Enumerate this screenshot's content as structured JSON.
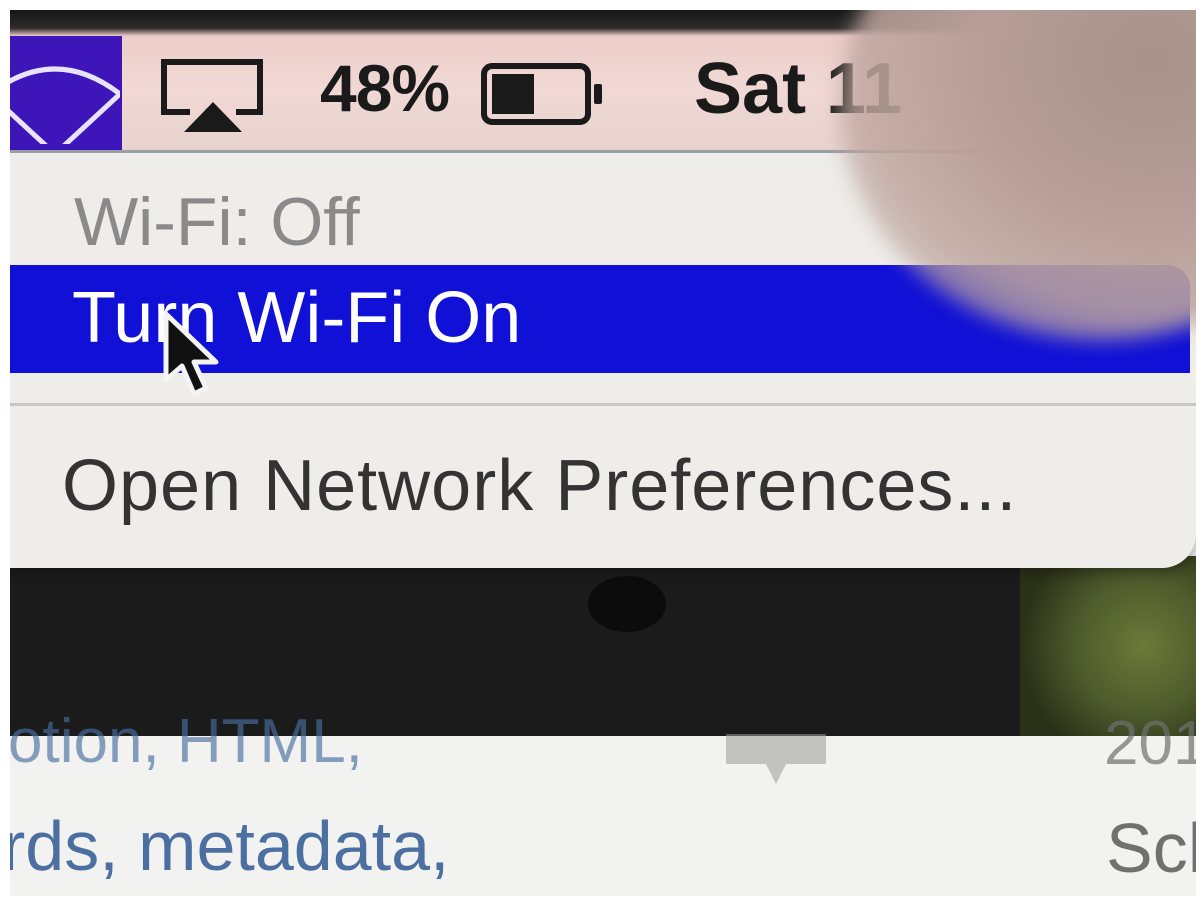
{
  "menubar": {
    "battery_percent": "48%",
    "battery_level": 0.48,
    "clock": "Sat 11"
  },
  "wifi_menu": {
    "status": "Wi-Fi: Off",
    "toggle": "Turn Wi-Fi On",
    "preferences": "Open Network Preferences..."
  },
  "background_page": {
    "line1": "otion, HTML,",
    "line2": "rds, metadata,",
    "right_line1": "201",
    "right_line2": "Sch"
  },
  "colors": {
    "wifi_tile": "#3d15b8",
    "highlight": "#1010d6",
    "link_text": "#4a6fa0"
  },
  "icons": {
    "wifi": "wifi-icon",
    "airplay": "airplay-icon",
    "battery": "battery-icon",
    "cursor": "mouse-pointer-icon"
  }
}
